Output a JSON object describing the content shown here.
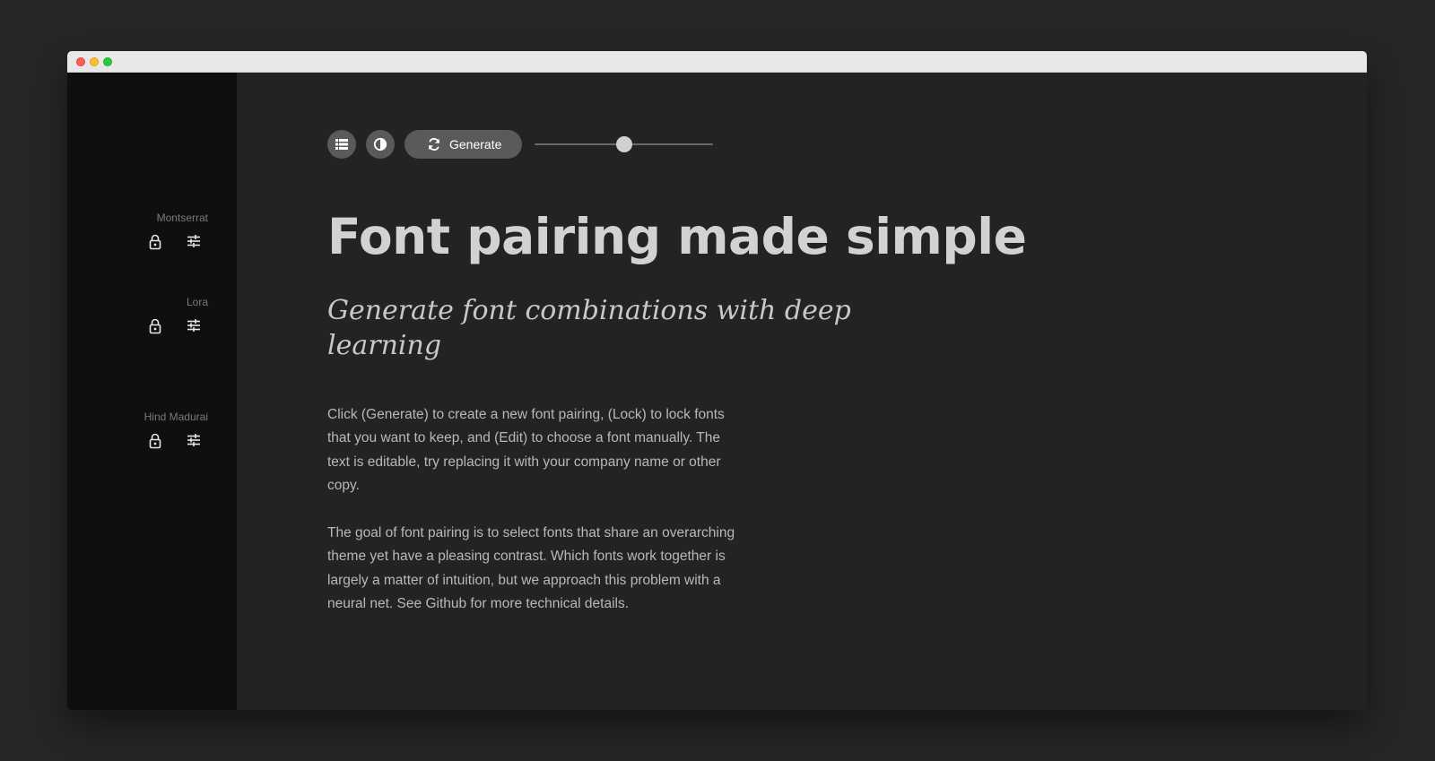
{
  "sidebar": {
    "fonts": [
      {
        "name": "Montserrat",
        "lock_icon": "lock-icon",
        "edit_icon": "tune-icon"
      },
      {
        "name": "Lora",
        "lock_icon": "lock-icon",
        "edit_icon": "tune-icon"
      },
      {
        "name": "Hind Madurai",
        "lock_icon": "lock-icon",
        "edit_icon": "tune-icon"
      }
    ]
  },
  "toolbar": {
    "list_icon": "list-icon",
    "contrast_icon": "contrast-icon",
    "generate_icon": "refresh-icon",
    "generate_label": "Generate",
    "slider_value_fraction": 0.5
  },
  "content": {
    "heading": "Font pairing made simple",
    "subheading": "Generate font combinations with deep learning",
    "paragraphs": [
      "Click (Generate) to create a new font pairing, (Lock) to lock fonts that you want to keep, and (Edit) to choose a font manually. The text is editable, try replacing it with your company name or other copy.",
      "The goal of font pairing is to select fonts that share an overarching theme yet have a pleasing contrast. Which fonts work together is largely a matter of intuition, but we approach this problem with a neural net. See Github for more technical details."
    ]
  },
  "colors": {
    "page_background": "#262626",
    "sidebar_background": "#0f0f0f",
    "main_background": "#232323",
    "button_background": "#5a5a5a",
    "heading_text": "#d2d2d2",
    "body_text": "#b8b8b8"
  }
}
